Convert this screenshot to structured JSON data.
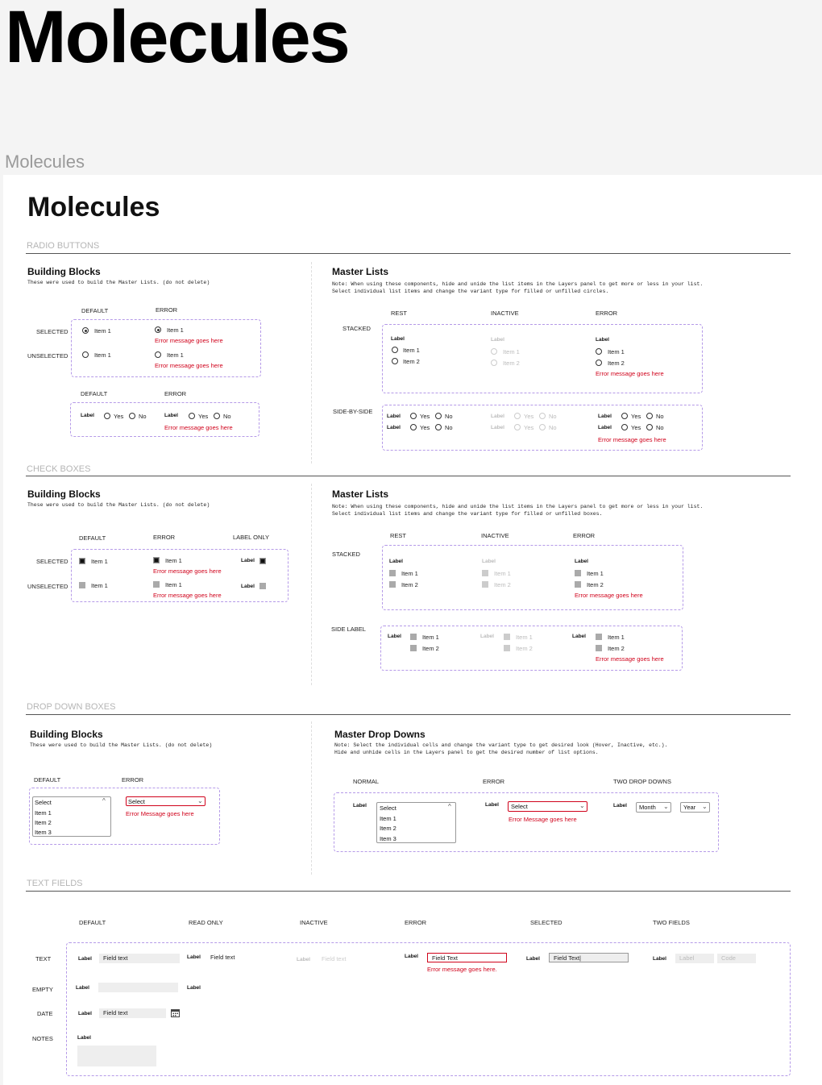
{
  "page": {
    "title": "Molecules",
    "subtitle": "Molecules",
    "card_title": "Molecules"
  },
  "sections": {
    "radio": "RADIO BUTTONS",
    "check": "CHECK BOXES",
    "dropdown": "DROP DOWN BOXES",
    "text": "TEXT FIELDS"
  },
  "common": {
    "building_blocks": "Building Blocks",
    "building_desc": "These were used to build the Master Lists. (do not delete)",
    "master_lists": "Master Lists",
    "master_drop_downs": "Master Drop Downs",
    "note_radio_1": "Note: When using these components, hide and unide the list items in the Layers panel to get more or less in your list.",
    "note_radio_2": "Select individual list items and change the variant type for filled or unfilled circles.",
    "note_check_1": "Note: When using these components, hide and unide the list items in the Layers panel to get more or less in your list.",
    "note_check_2": "Select individual list items and change the variant type for filled or unfilled boxes.",
    "note_dd_1": "Note: Select the individual cells and change the variant type to get desired look (Hover, Inactive, etc.).",
    "note_dd_2": "Hide and unhide cells in the Layers panel to get the desired number of list options."
  },
  "labels": {
    "default": "DEFAULT",
    "error": "ERROR",
    "label_only": "LABEL ONLY",
    "selected": "SELECTED",
    "unselected": "UNSELECTED",
    "rest": "REST",
    "inactive": "INACTIVE",
    "stacked": "STACKED",
    "side_by_side": "SIDE-BY-SIDE",
    "side_label": "SIDE LABEL",
    "normal": "NORMAL",
    "two_drop_downs": "TWO DROP DOWNS",
    "read_only": "READ ONLY",
    "selected2": "SELECTED",
    "two_fields": "TWO FIELDS",
    "text": "TEXT",
    "empty": "EMPTY",
    "date": "DATE",
    "notes": "NOTES"
  },
  "items": {
    "item1": "Item 1",
    "item2": "Item 2",
    "item3": "Item 3",
    "label": "Label",
    "yes": "Yes",
    "no": "No",
    "select": "Select",
    "month": "Month",
    "year": "Year",
    "field_text": "Field text",
    "field_text_cap": "Field Text",
    "code": "Code"
  },
  "errors": {
    "msg": "Error message goes here",
    "msg_cap": "Error Message goes here",
    "msg_dot": "Error message goes here."
  },
  "colors": {
    "error": "#d0021b",
    "dashed_border": "#b59ae8"
  },
  "icons": {
    "calendar": "calendar-icon",
    "chevron": "chevron-down-icon"
  }
}
